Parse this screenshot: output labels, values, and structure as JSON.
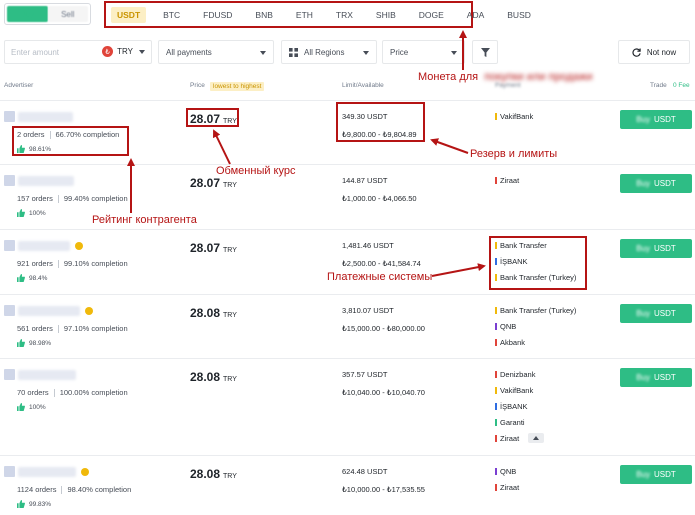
{
  "buy_sell": {
    "buy_label": "Buy",
    "sell_label": "Sell",
    "active": "buy"
  },
  "coins": [
    "USDT",
    "BTC",
    "FDUSD",
    "BNB",
    "ETH",
    "TRX",
    "SHIB",
    "DOGE",
    "ADA",
    "BUSD"
  ],
  "active_coin": "USDT",
  "filters": {
    "amount_placeholder": "Enter amount",
    "currency": "TRY",
    "currency_icon": "turkish-lira-icon",
    "payments": "All payments",
    "regions": "All Regions",
    "sort": "Price",
    "refresh": "Not now"
  },
  "headers": {
    "advertiser": "Advertiser",
    "price": "Price",
    "price_sort": "lowest to highest",
    "limit": "Limit/Available",
    "payment": "Payment",
    "trade": "Trade",
    "fee": "0 Fee"
  },
  "buy_button_label": "USDT",
  "rows": [
    {
      "orders": "2 orders",
      "completion": "66.70% completion",
      "rating": "98.61%",
      "verified": false,
      "price": "28.07",
      "currency": "TRY",
      "available": "349.30 USDT",
      "limits": "₺9,800.00 - ₺9,804.89",
      "payments": [
        {
          "name": "VakifBank",
          "color": "#f0b90b"
        }
      ]
    },
    {
      "orders": "157 orders",
      "completion": "99.40% completion",
      "rating": "100%",
      "verified": false,
      "price": "28.07",
      "currency": "TRY",
      "available": "144.87 USDT",
      "limits": "₺1,000.00 - ₺4,066.50",
      "payments": [
        {
          "name": "Ziraat",
          "color": "#e0443a"
        }
      ]
    },
    {
      "orders": "921 orders",
      "completion": "99.10% completion",
      "rating": "98.4%",
      "verified": true,
      "price": "28.07",
      "currency": "TRY",
      "available": "1,481.46 USDT",
      "limits": "₺2,500.00 - ₺41,584.74",
      "payments": [
        {
          "name": "Bank Transfer",
          "color": "#f0b90b"
        },
        {
          "name": "İŞBANK",
          "color": "#2f6de1"
        },
        {
          "name": "Bank Transfer (Turkey)",
          "color": "#f0b90b"
        }
      ]
    },
    {
      "orders": "561 orders",
      "completion": "97.10% completion",
      "rating": "98.98%",
      "verified": true,
      "price": "28.08",
      "currency": "TRY",
      "available": "3,810.07 USDT",
      "limits": "₺15,000.00 - ₺80,000.00",
      "payments": [
        {
          "name": "Bank Transfer (Turkey)",
          "color": "#f0b90b"
        },
        {
          "name": "QNB",
          "color": "#7a3fd1"
        },
        {
          "name": "Akbank",
          "color": "#e0443a"
        }
      ]
    },
    {
      "orders": "70 orders",
      "completion": "100.00% completion",
      "rating": "100%",
      "verified": false,
      "price": "28.08",
      "currency": "TRY",
      "available": "357.57 USDT",
      "limits": "₺10,040.00 - ₺10,040.70",
      "payments": [
        {
          "name": "Denizbank",
          "color": "#e0443a"
        },
        {
          "name": "VakifBank",
          "color": "#f0b90b"
        },
        {
          "name": "İŞBANK",
          "color": "#2f6de1"
        },
        {
          "name": "Garanti",
          "color": "#2ebd85"
        },
        {
          "name": "Ziraat",
          "color": "#e0443a"
        }
      ]
    },
    {
      "orders": "1124 orders",
      "completion": "98.40% completion",
      "rating": "99.83%",
      "verified": true,
      "price": "28.08",
      "currency": "TRY",
      "available": "624.48 USDT",
      "limits": "₺10,000.00 - ₺17,535.55",
      "payments": [
        {
          "name": "QNB",
          "color": "#7a3fd1"
        },
        {
          "name": "Ziraat",
          "color": "#e0443a"
        }
      ]
    }
  ],
  "annotations": {
    "coin": "Монета для",
    "rate": "Обменный курс",
    "reserve": "Резерв и лимиты",
    "rating": "Рейтинг контрагента",
    "payment_systems": "Платежные системы"
  },
  "colors": {
    "accent": "#f0b90b",
    "buy": "#2ebd85",
    "annotation": "#b51414"
  }
}
